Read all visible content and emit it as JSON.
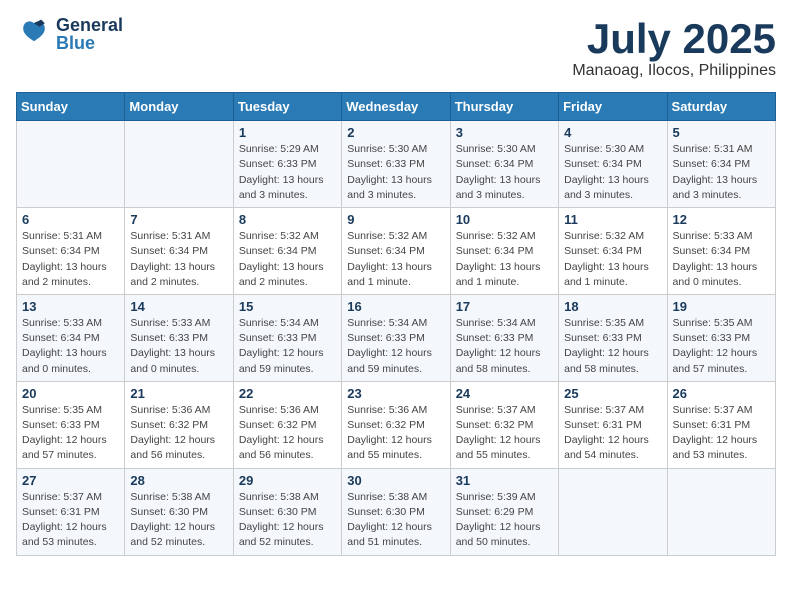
{
  "header": {
    "logo": {
      "general": "General",
      "blue": "Blue"
    },
    "month": "July 2025",
    "location": "Manaoag, Ilocos, Philippines"
  },
  "days_of_week": [
    "Sunday",
    "Monday",
    "Tuesday",
    "Wednesday",
    "Thursday",
    "Friday",
    "Saturday"
  ],
  "weeks": [
    [
      {
        "day": "",
        "info": ""
      },
      {
        "day": "",
        "info": ""
      },
      {
        "day": "1",
        "info": "Sunrise: 5:29 AM\nSunset: 6:33 PM\nDaylight: 13 hours and 3 minutes."
      },
      {
        "day": "2",
        "info": "Sunrise: 5:30 AM\nSunset: 6:33 PM\nDaylight: 13 hours and 3 minutes."
      },
      {
        "day": "3",
        "info": "Sunrise: 5:30 AM\nSunset: 6:34 PM\nDaylight: 13 hours and 3 minutes."
      },
      {
        "day": "4",
        "info": "Sunrise: 5:30 AM\nSunset: 6:34 PM\nDaylight: 13 hours and 3 minutes."
      },
      {
        "day": "5",
        "info": "Sunrise: 5:31 AM\nSunset: 6:34 PM\nDaylight: 13 hours and 3 minutes."
      }
    ],
    [
      {
        "day": "6",
        "info": "Sunrise: 5:31 AM\nSunset: 6:34 PM\nDaylight: 13 hours and 2 minutes."
      },
      {
        "day": "7",
        "info": "Sunrise: 5:31 AM\nSunset: 6:34 PM\nDaylight: 13 hours and 2 minutes."
      },
      {
        "day": "8",
        "info": "Sunrise: 5:32 AM\nSunset: 6:34 PM\nDaylight: 13 hours and 2 minutes."
      },
      {
        "day": "9",
        "info": "Sunrise: 5:32 AM\nSunset: 6:34 PM\nDaylight: 13 hours and 1 minute."
      },
      {
        "day": "10",
        "info": "Sunrise: 5:32 AM\nSunset: 6:34 PM\nDaylight: 13 hours and 1 minute."
      },
      {
        "day": "11",
        "info": "Sunrise: 5:32 AM\nSunset: 6:34 PM\nDaylight: 13 hours and 1 minute."
      },
      {
        "day": "12",
        "info": "Sunrise: 5:33 AM\nSunset: 6:34 PM\nDaylight: 13 hours and 0 minutes."
      }
    ],
    [
      {
        "day": "13",
        "info": "Sunrise: 5:33 AM\nSunset: 6:34 PM\nDaylight: 13 hours and 0 minutes."
      },
      {
        "day": "14",
        "info": "Sunrise: 5:33 AM\nSunset: 6:33 PM\nDaylight: 13 hours and 0 minutes."
      },
      {
        "day": "15",
        "info": "Sunrise: 5:34 AM\nSunset: 6:33 PM\nDaylight: 12 hours and 59 minutes."
      },
      {
        "day": "16",
        "info": "Sunrise: 5:34 AM\nSunset: 6:33 PM\nDaylight: 12 hours and 59 minutes."
      },
      {
        "day": "17",
        "info": "Sunrise: 5:34 AM\nSunset: 6:33 PM\nDaylight: 12 hours and 58 minutes."
      },
      {
        "day": "18",
        "info": "Sunrise: 5:35 AM\nSunset: 6:33 PM\nDaylight: 12 hours and 58 minutes."
      },
      {
        "day": "19",
        "info": "Sunrise: 5:35 AM\nSunset: 6:33 PM\nDaylight: 12 hours and 57 minutes."
      }
    ],
    [
      {
        "day": "20",
        "info": "Sunrise: 5:35 AM\nSunset: 6:33 PM\nDaylight: 12 hours and 57 minutes."
      },
      {
        "day": "21",
        "info": "Sunrise: 5:36 AM\nSunset: 6:32 PM\nDaylight: 12 hours and 56 minutes."
      },
      {
        "day": "22",
        "info": "Sunrise: 5:36 AM\nSunset: 6:32 PM\nDaylight: 12 hours and 56 minutes."
      },
      {
        "day": "23",
        "info": "Sunrise: 5:36 AM\nSunset: 6:32 PM\nDaylight: 12 hours and 55 minutes."
      },
      {
        "day": "24",
        "info": "Sunrise: 5:37 AM\nSunset: 6:32 PM\nDaylight: 12 hours and 55 minutes."
      },
      {
        "day": "25",
        "info": "Sunrise: 5:37 AM\nSunset: 6:31 PM\nDaylight: 12 hours and 54 minutes."
      },
      {
        "day": "26",
        "info": "Sunrise: 5:37 AM\nSunset: 6:31 PM\nDaylight: 12 hours and 53 minutes."
      }
    ],
    [
      {
        "day": "27",
        "info": "Sunrise: 5:37 AM\nSunset: 6:31 PM\nDaylight: 12 hours and 53 minutes."
      },
      {
        "day": "28",
        "info": "Sunrise: 5:38 AM\nSunset: 6:30 PM\nDaylight: 12 hours and 52 minutes."
      },
      {
        "day": "29",
        "info": "Sunrise: 5:38 AM\nSunset: 6:30 PM\nDaylight: 12 hours and 52 minutes."
      },
      {
        "day": "30",
        "info": "Sunrise: 5:38 AM\nSunset: 6:30 PM\nDaylight: 12 hours and 51 minutes."
      },
      {
        "day": "31",
        "info": "Sunrise: 5:39 AM\nSunset: 6:29 PM\nDaylight: 12 hours and 50 minutes."
      },
      {
        "day": "",
        "info": ""
      },
      {
        "day": "",
        "info": ""
      }
    ]
  ]
}
